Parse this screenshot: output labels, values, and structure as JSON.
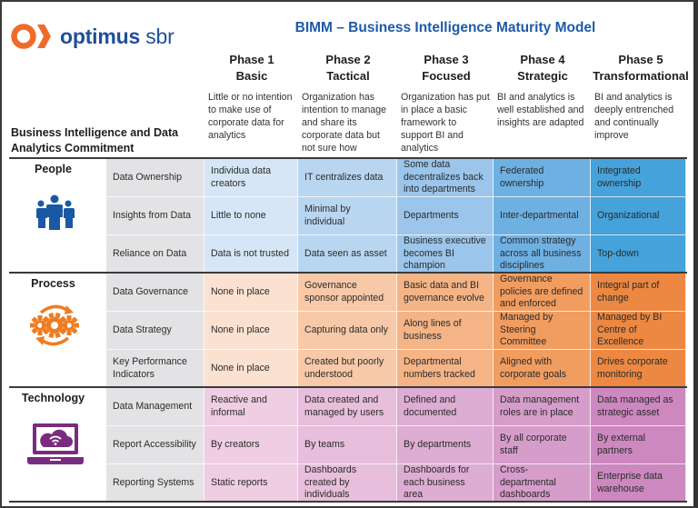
{
  "logo": {
    "brand_bold": "optimus",
    "brand_light": "sbr"
  },
  "title": "BIMM – Business Intelligence Maturity Model",
  "commitment_label": [
    "Business Intelligence and Data",
    "Analytics Commitment"
  ],
  "phases": [
    {
      "name": "Phase 1",
      "label": "Basic",
      "description": [
        "Little or no intention",
        "to make use of",
        "corporate data for",
        "analytics"
      ]
    },
    {
      "name": "Phase 2",
      "label": "Tactical",
      "description": [
        "Organization has",
        "intention to manage",
        "and share its",
        "corporate data but",
        "not sure how"
      ]
    },
    {
      "name": "Phase 3",
      "label": "Focused",
      "description": [
        "Organization has put",
        "in place a basic",
        "framework to",
        "support BI and",
        "analytics"
      ]
    },
    {
      "name": "Phase 4",
      "label": "Strategic",
      "description": [
        "BI and analytics is",
        "well established and",
        "insights are adapted"
      ]
    },
    {
      "name": "Phase 5",
      "label": "Transformational",
      "description": [
        "BI and analytics is",
        "deeply entrenched",
        "and continually",
        "improve"
      ]
    }
  ],
  "sections": [
    {
      "title": "People",
      "icon": "people-group-icon",
      "colors": [
        "#d6e6f6",
        "#b9d6f1",
        "#9bc5ea",
        "#6fb0e3",
        "#45a2da"
      ],
      "icon_color": "#1b58a3",
      "rows": [
        {
          "category": "Data Ownership",
          "cells": [
            "Individua data creators",
            "IT centralizes data",
            "Some data decentralizes back into departments",
            "Federated ownership",
            "Integrated ownership"
          ]
        },
        {
          "category": "Insights from Data",
          "cells": [
            "Little to none",
            "Minimal by individual",
            "Departments",
            "Inter-departmental",
            "Organizational"
          ]
        },
        {
          "category": "Reliance on Data",
          "cells": [
            "Data is not trusted",
            "Data seen as asset",
            "Business executive becomes BI champion",
            "Common strategy across all business disciplines",
            "Top-down"
          ]
        }
      ]
    },
    {
      "title": "Process",
      "icon": "gears-cycle-icon",
      "colors": [
        "#fbe1d0",
        "#f8c9a8",
        "#f5b486",
        "#f19d60",
        "#ec8842"
      ],
      "icon_color": "#ef7c22",
      "rows": [
        {
          "category": "Data Governance",
          "cells": [
            "None in place",
            "Governance sponsor appointed",
            "Basic data and BI governance evolve",
            "Governance policies are defined and enforced",
            "Integral part of change"
          ]
        },
        {
          "category": "Data Strategy",
          "cells": [
            "None in place",
            "Capturing data only",
            "Along lines of business",
            "Managed by Steering Committee",
            "Managed by BI Centre of Excellence"
          ]
        },
        {
          "category": "Key Performance Indicators",
          "cells": [
            "None in place",
            "Created but poorly understood",
            "Departmental numbers tracked",
            "Aligned with corporate goals",
            "Drives corporate monitoring"
          ]
        }
      ]
    },
    {
      "title": "Technology",
      "icon": "laptop-cloud-icon",
      "colors": [
        "#efcde3",
        "#e7bedb",
        "#deadd3",
        "#d69dcb",
        "#cc88bf"
      ],
      "icon_color": "#7b2b7f",
      "rows": [
        {
          "category": "Data Management",
          "cells": [
            "Reactive and informal",
            "Data created and managed by users",
            "Defined and documented",
            "Data management roles are in place",
            "Data managed as strategic asset"
          ]
        },
        {
          "category": "Report Accessibility",
          "cells": [
            "By creators",
            "By teams",
            "By departments",
            "By all corporate staff",
            "By external partners"
          ]
        },
        {
          "category": "Reporting Systems",
          "cells": [
            "Static reports",
            "Dashboards created by individuals",
            "Dashboards for each business area",
            "Cross-departmental dashboards",
            "Enterprise data warehouse"
          ]
        }
      ]
    }
  ],
  "colors": {
    "brand_orange": "#ef6b2c",
    "brand_blue": "#1f4e9a",
    "title_blue": "#1f5ba8",
    "category_gray": "#e3e3e5"
  }
}
